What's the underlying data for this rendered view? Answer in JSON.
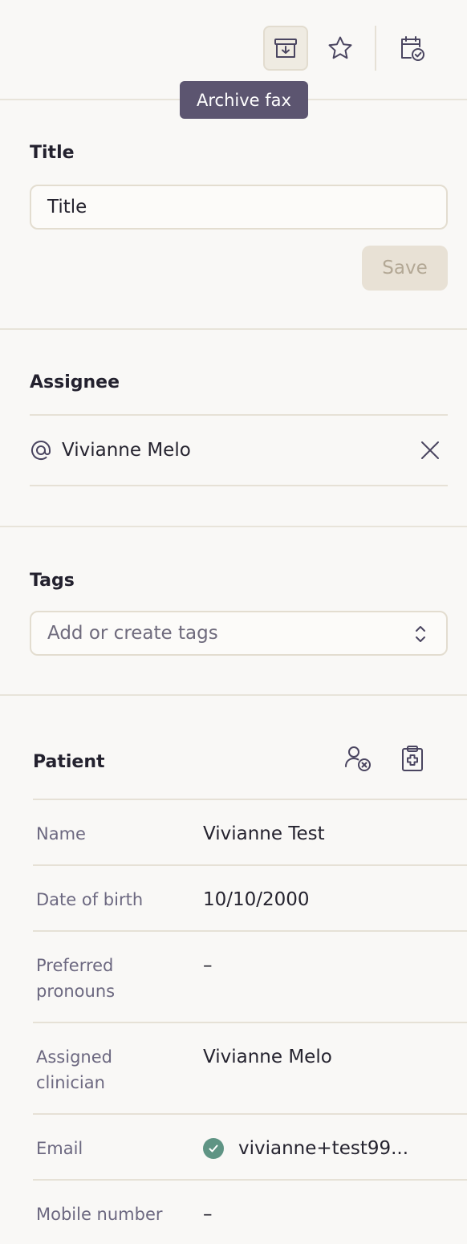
{
  "toolbar": {
    "archive_tooltip": "Archive fax",
    "icons": [
      "archive-icon",
      "star-icon",
      "calendar-check-icon"
    ]
  },
  "title_section": {
    "label": "Title",
    "input_value": "Title",
    "save_label": "Save"
  },
  "assignee_section": {
    "label": "Assignee",
    "assignee_name": "Vivianne Melo"
  },
  "tags_section": {
    "label": "Tags",
    "placeholder": "Add or create tags"
  },
  "patient_section": {
    "label": "Patient",
    "rows": [
      {
        "key": "Name",
        "value": "Vivianne Test"
      },
      {
        "key": "Date of birth",
        "value": "10/10/2000"
      },
      {
        "key": "Preferred pronouns",
        "value": "–"
      },
      {
        "key": "Assigned clinician",
        "value": "Vivianne Melo"
      },
      {
        "key": "Email",
        "value": "vivianne+test99..."
      },
      {
        "key": "Mobile number",
        "value": "–"
      }
    ]
  },
  "colors": {
    "background": "#f9f8f6",
    "tooltip": "#5c5570",
    "verified": "#5f9484",
    "save_disabled": "#e8e1d5"
  }
}
